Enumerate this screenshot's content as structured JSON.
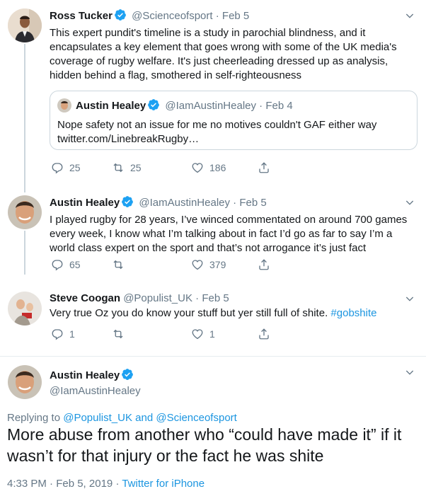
{
  "colors": {
    "accent": "#1da1f2",
    "link": "#1b95e0",
    "muted": "#657786",
    "border": "#e6ecf0"
  },
  "tweets": [
    {
      "name": "Ross Tucker",
      "handle": "@Scienceofsport",
      "dot": "·",
      "date": "Feb 5",
      "verified": true,
      "text": "This expert pundit's timeline is a study in parochial blindness, and it encapsulates a key element that goes wrong with some of the UK media's coverage of rugby welfare. It's just cheerleading dressed up as analysis, hidden behind a flag, smothered in self-righteousness",
      "quote": {
        "name": "Austin Healey",
        "handle": "@IamAustinHealey",
        "dot": "·",
        "date": "Feb 4",
        "text_line1": "Nope safety not an issue for me no motives couldn't GAF either way",
        "text_line2": "twitter.com/LinebreakRugby…"
      },
      "replies": "25",
      "retweets": "25",
      "likes": "186"
    },
    {
      "name": "Austin Healey",
      "handle": "@IamAustinHealey",
      "dot": "·",
      "date": "Feb 5",
      "verified": true,
      "text": "I played rugby for 28 years, I’ve winced commentated on around 700 games every week, I know what I’m talking about in fact I’d go as far to say I’m a world class expert on the sport and that’s not arrogance it’s just fact",
      "replies": "65",
      "retweets": "",
      "likes": "379"
    },
    {
      "name": "Steve Coogan",
      "handle": "@Populist_UK",
      "dot": "·",
      "date": "Feb 5",
      "verified": false,
      "text": "Very true Oz you do know your stuff but yer still full of shite.",
      "hashtag": "#gobshite",
      "replies": "1",
      "retweets": "",
      "likes": "1"
    }
  ],
  "main": {
    "name": "Austin Healey",
    "handle": "@IamAustinHealey",
    "replying_prefix": "Replying to",
    "reply_user1": "@Populist_UK",
    "reply_and": "and",
    "reply_user2": "@Scienceofsport",
    "text": "More abuse from another who “could have made it” if it wasn’t for that injury or the fact he was shite",
    "time": "4:33 PM · Feb 5, 2019",
    "dot": "·",
    "source": "Twitter for iPhone"
  }
}
